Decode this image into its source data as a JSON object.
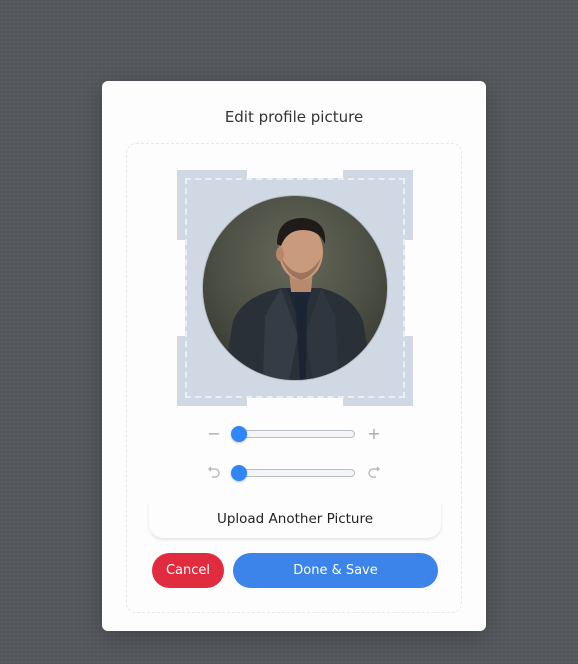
{
  "dialog": {
    "title": "Edit profile picture"
  },
  "cropper": {
    "image_alt": "profile-photo",
    "zoom": {
      "level": 0.0,
      "minus_icon": "minus-icon",
      "plus_icon": "plus-icon"
    },
    "rotate": {
      "level": 0.0,
      "left_icon": "rotate-left-icon",
      "right_icon": "rotate-right-icon"
    }
  },
  "actions": {
    "upload_label": "Upload Another Picture",
    "cancel_label": "Cancel",
    "save_label": "Done & Save"
  },
  "colors": {
    "accent": "#3c83ea",
    "slider_thumb": "#2f86f6",
    "danger": "#e12b3e",
    "backdrop": "#54575c"
  }
}
